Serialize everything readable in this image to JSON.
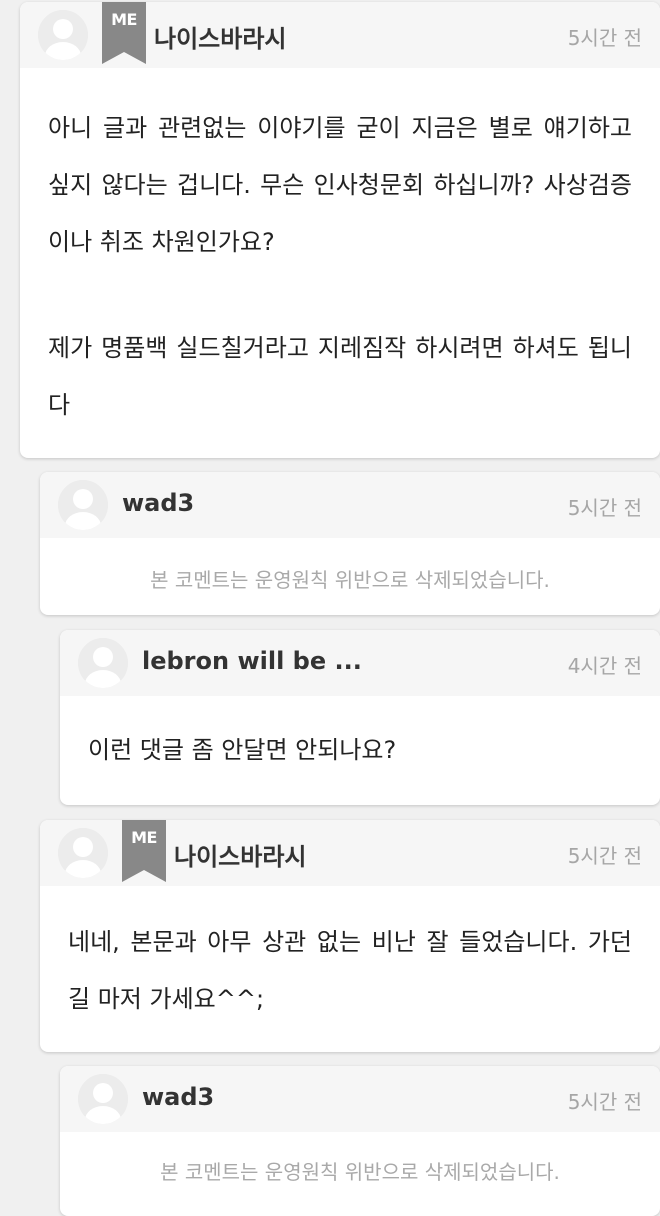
{
  "comments": [
    {
      "username": "나이스바라시",
      "badge": "ME",
      "time": "5시간 전",
      "paragraphs": [
        "아니 글과 관련없는 이야기를 굳이 지금은 별로 얘기하고 싶지 않다는 겁니다. 무슨 인사청문회 하십니까? 사상검증이나 취조 차원인가요?",
        "제가 명품백 실드칠거라고 지레짐작 하시려면 하셔도 됩니다"
      ]
    },
    {
      "username": "wad3",
      "time": "5시간 전",
      "deleted_text": "본 코멘트는 운영원칙 위반으로 삭제되었습니다."
    },
    {
      "username": "lebron will be ...",
      "time": "4시간 전",
      "text": "이런 댓글 좀 안달면 안되나요?"
    },
    {
      "username": "나이스바라시",
      "badge": "ME",
      "time": "5시간 전",
      "text": "네네, 본문과 아무 상관 없는 비난 잘 들었습니다. 가던 길 마저 가세요^^;"
    },
    {
      "username": "wad3",
      "time": "5시간 전",
      "deleted_text": "본 코멘트는 운영원칙 위반으로 삭제되었습니다."
    }
  ],
  "colors": {
    "page_bg": "#f0f0f0",
    "card_bg": "#ffffff",
    "header_bg": "#f6f6f6",
    "badge": "#888888",
    "time": "#a6a6a6",
    "deleted": "#a9a9a9"
  }
}
